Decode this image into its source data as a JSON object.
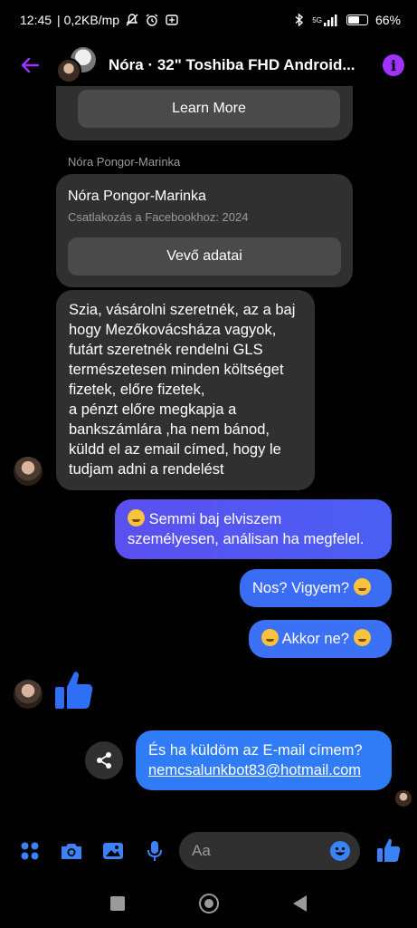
{
  "status_bar": {
    "time": "12:45",
    "speed": "| 0,2KB/mp",
    "network": "5G",
    "battery_percent": "66%",
    "battery_level": 0.66
  },
  "header": {
    "title": "Nóra · 32\" Toshiba FHD Android...",
    "accent_color": "#a033ff"
  },
  "listing_card": {
    "learn_more_label": "Learn More"
  },
  "sender_label": "Nóra Pongor-Marinka",
  "profile_card": {
    "name": "Nóra Pongor-Marinka",
    "subtitle": "Csatlakozás a Facebookhoz: 2024",
    "button_label": "Vevő adatai"
  },
  "messages": {
    "incoming_lines": [
      "Szia, vásárolni szeretnék, az a baj",
      "hogy Mezőkovácsháza vagyok,",
      "futárt szeretnék rendelni GLS",
      "természetesen minden költséget",
      "fizetek, előre fizetek,",
      "a pénzt előre megkapja a",
      "bankszámlára ,ha nem bánod,",
      "küldd el az email címed, hogy le",
      "tudjam adni a rendelést"
    ],
    "out1_line1": " Semmi baj elviszem",
    "out1_line2": "személyesen, análisan ha megfelel.",
    "out2": "Nos? Vigyem? ",
    "out3": " Akkor ne? ",
    "out4_line1": "És ha küldöm az E-mail címem?",
    "out4_link": "nemcsalunkbot83@hotmail.com"
  },
  "composer": {
    "placeholder": "Aa",
    "icon_color": "#3b82f6"
  },
  "icons": {
    "back": "arrow-left-icon",
    "info": "info-icon",
    "share": "share-icon",
    "apps": "apps-icon",
    "camera": "camera-icon",
    "gallery": "image-icon",
    "mic": "microphone-icon",
    "emoji": "emoji-icon",
    "like": "thumbs-up-icon"
  }
}
